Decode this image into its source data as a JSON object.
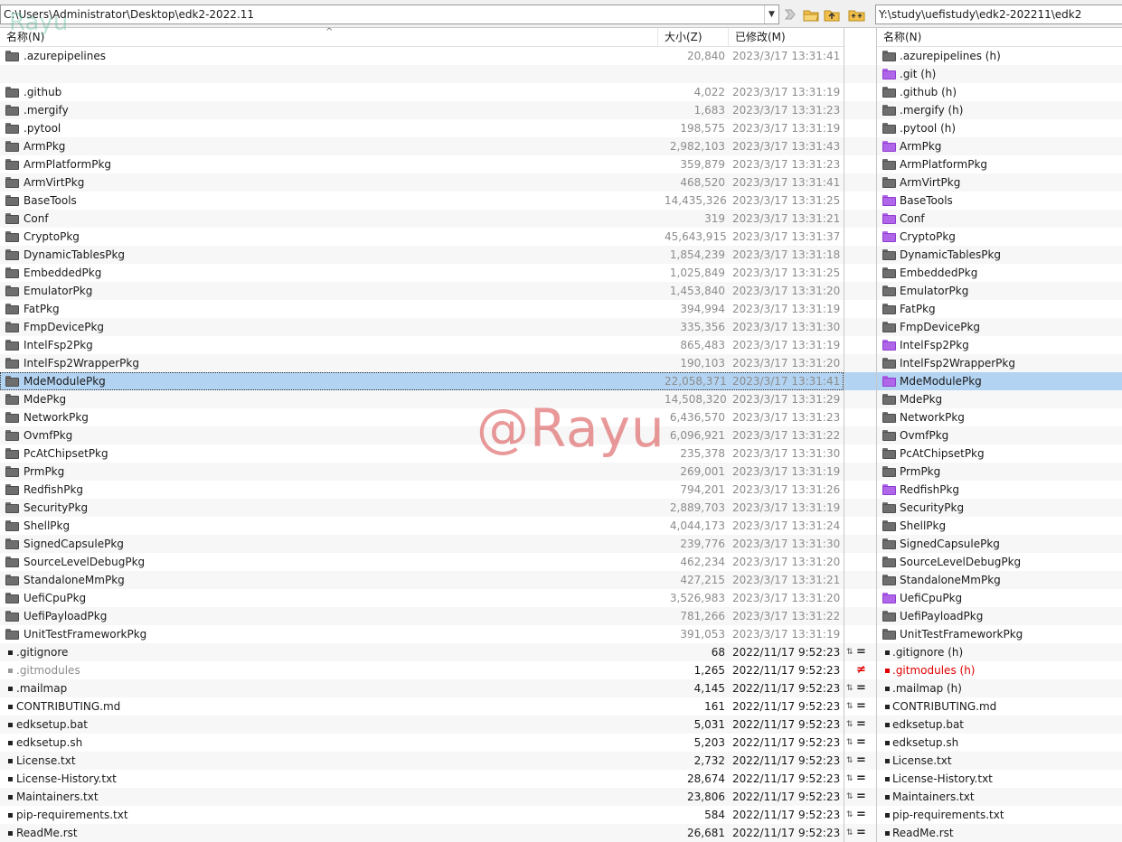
{
  "toolbar": {
    "left_path": "C:\\Users\\Administrator\\Desktop\\edk2-2022.11",
    "right_path": "Y:\\study\\uefistudy\\edk2-202211\\edk2",
    "watermark_top": "Rayu"
  },
  "headers": {
    "left": {
      "name": "名称(N)",
      "size": "大小(Z)",
      "modified": "已修改(M)"
    },
    "right": {
      "name": "名称(N)"
    }
  },
  "left_rows": [
    {
      "name": ".azurepipelines",
      "size": "20,840",
      "date": "2023/3/17 13:31:41",
      "type": "folder"
    },
    {
      "name": "",
      "size": "",
      "date": "",
      "type": "empty"
    },
    {
      "name": ".github",
      "size": "4,022",
      "date": "2023/3/17 13:31:19",
      "type": "folder"
    },
    {
      "name": ".mergify",
      "size": "1,683",
      "date": "2023/3/17 13:31:23",
      "type": "folder"
    },
    {
      "name": ".pytool",
      "size": "198,575",
      "date": "2023/3/17 13:31:19",
      "type": "folder"
    },
    {
      "name": "ArmPkg",
      "size": "2,982,103",
      "date": "2023/3/17 13:31:43",
      "type": "folder"
    },
    {
      "name": "ArmPlatformPkg",
      "size": "359,879",
      "date": "2023/3/17 13:31:23",
      "type": "folder"
    },
    {
      "name": "ArmVirtPkg",
      "size": "468,520",
      "date": "2023/3/17 13:31:41",
      "type": "folder"
    },
    {
      "name": "BaseTools",
      "size": "14,435,326",
      "date": "2023/3/17 13:31:25",
      "type": "folder"
    },
    {
      "name": "Conf",
      "size": "319",
      "date": "2023/3/17 13:31:21",
      "type": "folder"
    },
    {
      "name": "CryptoPkg",
      "size": "45,643,915",
      "date": "2023/3/17 13:31:37",
      "type": "folder"
    },
    {
      "name": "DynamicTablesPkg",
      "size": "1,854,239",
      "date": "2023/3/17 13:31:18",
      "type": "folder"
    },
    {
      "name": "EmbeddedPkg",
      "size": "1,025,849",
      "date": "2023/3/17 13:31:25",
      "type": "folder"
    },
    {
      "name": "EmulatorPkg",
      "size": "1,453,840",
      "date": "2023/3/17 13:31:20",
      "type": "folder"
    },
    {
      "name": "FatPkg",
      "size": "394,994",
      "date": "2023/3/17 13:31:19",
      "type": "folder"
    },
    {
      "name": "FmpDevicePkg",
      "size": "335,356",
      "date": "2023/3/17 13:31:30",
      "type": "folder"
    },
    {
      "name": "IntelFsp2Pkg",
      "size": "865,483",
      "date": "2023/3/17 13:31:19",
      "type": "folder"
    },
    {
      "name": "IntelFsp2WrapperPkg",
      "size": "190,103",
      "date": "2023/3/17 13:31:20",
      "type": "folder"
    },
    {
      "name": "MdeModulePkg",
      "size": "22,058,371",
      "date": "2023/3/17 13:31:41",
      "type": "folder",
      "selected": true
    },
    {
      "name": "MdePkg",
      "size": "14,508,320",
      "date": "2023/3/17 13:31:29",
      "type": "folder"
    },
    {
      "name": "NetworkPkg",
      "size": "6,436,570",
      "date": "2023/3/17 13:31:23",
      "type": "folder"
    },
    {
      "name": "OvmfPkg",
      "size": "6,096,921",
      "date": "2023/3/17 13:31:22",
      "type": "folder"
    },
    {
      "name": "PcAtChipsetPkg",
      "size": "235,378",
      "date": "2023/3/17 13:31:30",
      "type": "folder"
    },
    {
      "name": "PrmPkg",
      "size": "269,001",
      "date": "2023/3/17 13:31:19",
      "type": "folder"
    },
    {
      "name": "RedfishPkg",
      "size": "794,201",
      "date": "2023/3/17 13:31:26",
      "type": "folder"
    },
    {
      "name": "SecurityPkg",
      "size": "2,889,703",
      "date": "2023/3/17 13:31:19",
      "type": "folder"
    },
    {
      "name": "ShellPkg",
      "size": "4,044,173",
      "date": "2023/3/17 13:31:24",
      "type": "folder"
    },
    {
      "name": "SignedCapsulePkg",
      "size": "239,776",
      "date": "2023/3/17 13:31:30",
      "type": "folder"
    },
    {
      "name": "SourceLevelDebugPkg",
      "size": "462,234",
      "date": "2023/3/17 13:31:20",
      "type": "folder"
    },
    {
      "name": "StandaloneMmPkg",
      "size": "427,215",
      "date": "2023/3/17 13:31:21",
      "type": "folder"
    },
    {
      "name": "UefiCpuPkg",
      "size": "3,526,983",
      "date": "2023/3/17 13:31:20",
      "type": "folder"
    },
    {
      "name": "UefiPayloadPkg",
      "size": "781,266",
      "date": "2023/3/17 13:31:22",
      "type": "folder"
    },
    {
      "name": "UnitTestFrameworkPkg",
      "size": "391,053",
      "date": "2023/3/17 13:31:19",
      "type": "folder"
    },
    {
      "name": ".gitignore",
      "size": "68",
      "date": "2022/11/17 9:52:23",
      "type": "file",
      "cmp": "eq"
    },
    {
      "name": ".gitmodules",
      "size": "1,265",
      "date": "2022/11/17 9:52:23",
      "type": "file-diff",
      "cmp": "neq"
    },
    {
      "name": ".mailmap",
      "size": "4,145",
      "date": "2022/11/17 9:52:23",
      "type": "file",
      "cmp": "eq"
    },
    {
      "name": "CONTRIBUTING.md",
      "size": "161",
      "date": "2022/11/17 9:52:23",
      "type": "file",
      "cmp": "eq"
    },
    {
      "name": "edksetup.bat",
      "size": "5,031",
      "date": "2022/11/17 9:52:23",
      "type": "file",
      "cmp": "eq"
    },
    {
      "name": "edksetup.sh",
      "size": "5,203",
      "date": "2022/11/17 9:52:23",
      "type": "file",
      "cmp": "eq"
    },
    {
      "name": "License.txt",
      "size": "2,732",
      "date": "2022/11/17 9:52:23",
      "type": "file",
      "cmp": "eq"
    },
    {
      "name": "License-History.txt",
      "size": "28,674",
      "date": "2022/11/17 9:52:23",
      "type": "file",
      "cmp": "eq"
    },
    {
      "name": "Maintainers.txt",
      "size": "23,806",
      "date": "2022/11/17 9:52:23",
      "type": "file",
      "cmp": "eq"
    },
    {
      "name": "pip-requirements.txt",
      "size": "584",
      "date": "2022/11/17 9:52:23",
      "type": "file",
      "cmp": "eq"
    },
    {
      "name": "ReadMe.rst",
      "size": "26,681",
      "date": "2022/11/17 9:52:23",
      "type": "file",
      "cmp": "eq"
    }
  ],
  "right_rows": [
    {
      "name": ".azurepipelines (h)",
      "type": "folder-gray"
    },
    {
      "name": ".git (h)",
      "type": "folder-purple"
    },
    {
      "name": ".github (h)",
      "type": "folder-gray"
    },
    {
      "name": ".mergify (h)",
      "type": "folder-gray"
    },
    {
      "name": ".pytool (h)",
      "type": "folder-gray"
    },
    {
      "name": "ArmPkg",
      "type": "folder-purple"
    },
    {
      "name": "ArmPlatformPkg",
      "type": "folder-gray"
    },
    {
      "name": "ArmVirtPkg",
      "type": "folder-gray"
    },
    {
      "name": "BaseTools",
      "type": "folder-purple"
    },
    {
      "name": "Conf",
      "type": "folder-purple"
    },
    {
      "name": "CryptoPkg",
      "type": "folder-purple"
    },
    {
      "name": "DynamicTablesPkg",
      "type": "folder-gray"
    },
    {
      "name": "EmbeddedPkg",
      "type": "folder-gray"
    },
    {
      "name": "EmulatorPkg",
      "type": "folder-gray"
    },
    {
      "name": "FatPkg",
      "type": "folder-gray"
    },
    {
      "name": "FmpDevicePkg",
      "type": "folder-gray"
    },
    {
      "name": "IntelFsp2Pkg",
      "type": "folder-purple"
    },
    {
      "name": "IntelFsp2WrapperPkg",
      "type": "folder-gray"
    },
    {
      "name": "MdeModulePkg",
      "type": "folder-purple",
      "selected": true
    },
    {
      "name": "MdePkg",
      "type": "folder-gray"
    },
    {
      "name": "NetworkPkg",
      "type": "folder-gray"
    },
    {
      "name": "OvmfPkg",
      "type": "folder-gray"
    },
    {
      "name": "PcAtChipsetPkg",
      "type": "folder-gray"
    },
    {
      "name": "PrmPkg",
      "type": "folder-gray"
    },
    {
      "name": "RedfishPkg",
      "type": "folder-purple"
    },
    {
      "name": "SecurityPkg",
      "type": "folder-gray"
    },
    {
      "name": "ShellPkg",
      "type": "folder-gray"
    },
    {
      "name": "SignedCapsulePkg",
      "type": "folder-gray"
    },
    {
      "name": "SourceLevelDebugPkg",
      "type": "folder-gray"
    },
    {
      "name": "StandaloneMmPkg",
      "type": "folder-gray"
    },
    {
      "name": "UefiCpuPkg",
      "type": "folder-purple"
    },
    {
      "name": "UefiPayloadPkg",
      "type": "folder-gray"
    },
    {
      "name": "UnitTestFrameworkPkg",
      "type": "folder-gray"
    },
    {
      "name": ".gitignore (h)",
      "type": "file"
    },
    {
      "name": ".gitmodules (h)",
      "type": "file-diff"
    },
    {
      "name": ".mailmap (h)",
      "type": "file"
    },
    {
      "name": "CONTRIBUTING.md",
      "type": "file"
    },
    {
      "name": "edksetup.bat",
      "type": "file"
    },
    {
      "name": "edksetup.sh",
      "type": "file"
    },
    {
      "name": "License.txt",
      "type": "file"
    },
    {
      "name": "License-History.txt",
      "type": "file"
    },
    {
      "name": "Maintainers.txt",
      "type": "file"
    },
    {
      "name": "pip-requirements.txt",
      "type": "file"
    },
    {
      "name": "ReadMe.rst",
      "type": "file"
    }
  ],
  "compare_symbols": {
    "eq": "=",
    "neq": "≠",
    "arrows": "⇅"
  },
  "watermark": "@Rayu",
  "colors": {
    "selection": "#b3d3f2",
    "diff": "#e00000",
    "purple_folder": "#b066e8",
    "gray_folder": "#6e6e6e"
  }
}
